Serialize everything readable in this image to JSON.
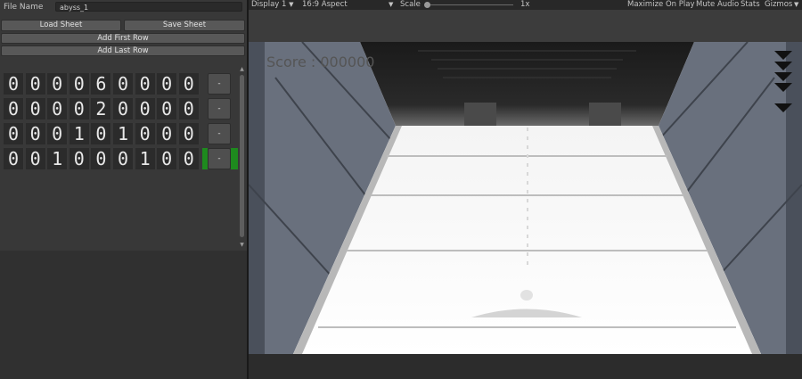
{
  "inspector": {
    "file_name_label": "File Name",
    "file_name_value": "abyss_1",
    "load_sheet": "Load Sheet",
    "save_sheet": "Save Sheet",
    "add_first_row": "Add First Row",
    "add_last_row": "Add Last Row",
    "rows": [
      {
        "cells": [
          "0",
          "0",
          "0",
          "0",
          "6",
          "0",
          "0",
          "0",
          "0"
        ],
        "remove": "-"
      },
      {
        "cells": [
          "0",
          "0",
          "0",
          "0",
          "2",
          "0",
          "0",
          "0",
          "0"
        ],
        "remove": "-"
      },
      {
        "cells": [
          "0",
          "0",
          "0",
          "1",
          "0",
          "1",
          "0",
          "0",
          "0"
        ],
        "remove": "-"
      },
      {
        "cells": [
          "0",
          "0",
          "1",
          "0",
          "0",
          "0",
          "1",
          "0",
          "0"
        ],
        "remove": "-"
      }
    ],
    "highlight_color": "#1e8a1e"
  },
  "toolbar": {
    "display": "Display 1",
    "aspect": "16:9 Aspect",
    "scale_label": "Scale",
    "scale_value": "1x",
    "maximize": "Maximize On Play",
    "mute": "Mute Audio",
    "stats": "Stats",
    "gizmos": "Gizmos"
  },
  "game": {
    "score": "Score : 000000"
  }
}
